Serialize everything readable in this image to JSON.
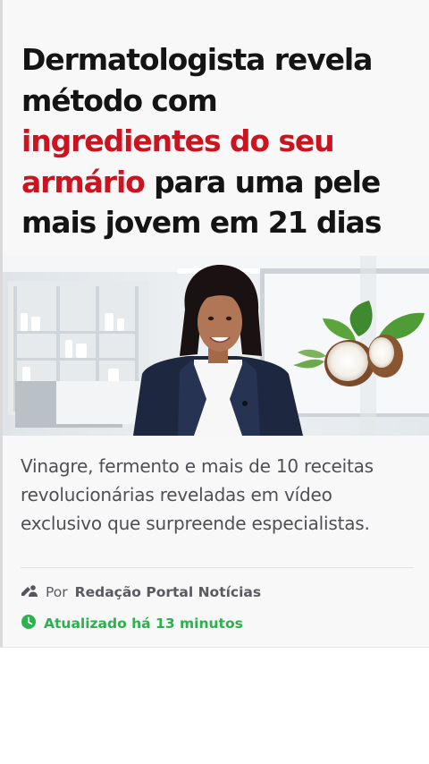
{
  "article": {
    "headline": {
      "part1": "Dermatologista revela método com ",
      "highlight": "ingredientes do seu armário",
      "part2": " para uma pele mais jovem em 21 dias"
    },
    "dek": "Vinagre, fermento e mais de 10 receitas revolucionárias reveladas em vídeo exclusivo que surpreende especialistas.",
    "byline": {
      "prefix": "Por",
      "author": "Redação Portal Notícias",
      "icon": "edit-user-icon"
    },
    "updated": {
      "text": "Atualizado há 13 minutos",
      "icon": "clock-icon"
    }
  },
  "colors": {
    "highlight": "#cc1420",
    "updated": "#2bb24c",
    "headline": "#141414",
    "body_text": "#4f4f55"
  }
}
